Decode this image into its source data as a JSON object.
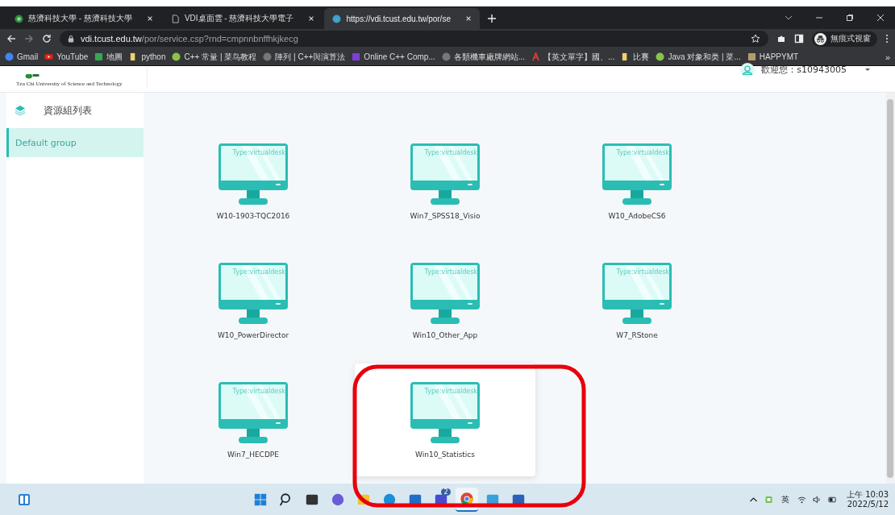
{
  "browser": {
    "tabs": [
      {
        "title": "慈濟科技大學 - 慈濟科技大學",
        "selected": false
      },
      {
        "title": "VDI桌面雲 - 慈濟科技大學電子",
        "selected": false
      },
      {
        "title": "https://vdi.tcust.edu.tw/por/se",
        "selected": true
      }
    ],
    "address": {
      "host": "vdi.tcust.edu.tw",
      "path": "/por/service.csp?rnd=cmpnnbnffhkjkecg"
    },
    "profile": "無痕式視窗",
    "bookmarks": [
      {
        "label": "Gmail"
      },
      {
        "label": "YouTube"
      },
      {
        "label": "地圖"
      },
      {
        "label": "python"
      },
      {
        "label": "C++ 常量 | 菜鸟教程"
      },
      {
        "label": "陣列 | C++與演算法"
      },
      {
        "label": "Online C++ Comp..."
      },
      {
        "label": "各類機車廠牌網站..."
      },
      {
        "label": "【英文單字】國、..."
      },
      {
        "label": "比賽"
      },
      {
        "label": "Java 对象和类 | 菜..."
      },
      {
        "label": "HAPPYMT"
      }
    ],
    "more": "»"
  },
  "header": {
    "school_subtitle": "Tzu Chi University of Science and Technology",
    "welcome": "歡迎您：s10943005"
  },
  "sidebar": {
    "title": "資源組列表",
    "groups": [
      {
        "label": "Default group",
        "selected": true
      }
    ]
  },
  "desktops": [
    {
      "name": "W10-1903-TQC2016",
      "type": "Type:virtualdesk",
      "selected": false
    },
    {
      "name": "Win7_SPSS18_Visio",
      "type": "Type:virtualdesk",
      "selected": false
    },
    {
      "name": "W10_AdobeCS6",
      "type": "Type:virtualdesk",
      "selected": false
    },
    {
      "name": "W10_PowerDirector",
      "type": "Type:virtualdesk",
      "selected": false
    },
    {
      "name": "Win10_Other_App",
      "type": "Type:virtualdesk",
      "selected": false
    },
    {
      "name": "W7_RStone",
      "type": "Type:virtualdesk",
      "selected": false
    },
    {
      "name": "Win7_HECDPE",
      "type": "Type:virtualdesk",
      "selected": false
    },
    {
      "name": "Win10_Statistics",
      "type": "Type:virtualdesk",
      "selected": true
    }
  ],
  "taskbar": {
    "apps": [
      {
        "selected": false
      },
      {
        "selected": false
      },
      {
        "selected": false
      },
      {
        "selected": false
      },
      {
        "selected": false
      },
      {
        "selected": false
      },
      {
        "selected": false
      },
      {
        "selected": false,
        "badge": "2"
      },
      {
        "selected": true
      },
      {
        "selected": false
      },
      {
        "selected": false
      }
    ],
    "ime": "英",
    "time": "上午 10:03",
    "date": "2022/5/12"
  }
}
